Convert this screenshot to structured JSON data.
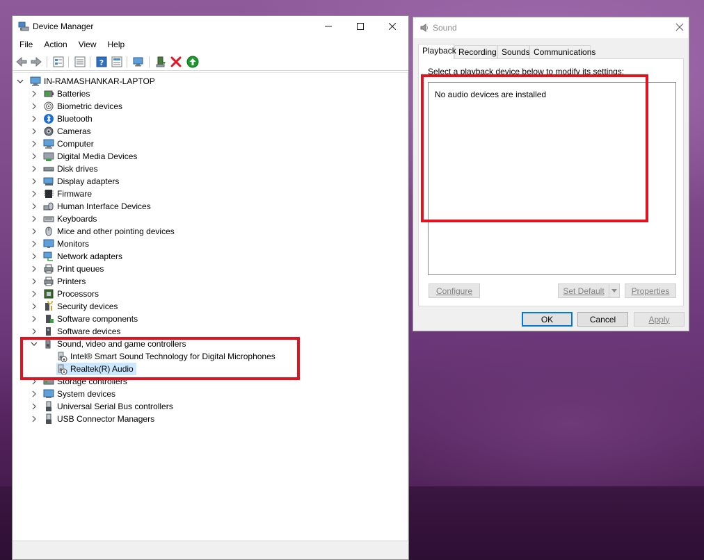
{
  "device_manager": {
    "title": "Device Manager",
    "menu": [
      "File",
      "Action",
      "View",
      "Help"
    ],
    "root": "IN-RAMASHANKAR-LAPTOP",
    "categories": [
      {
        "label": "Batteries",
        "icon": "battery-icon"
      },
      {
        "label": "Biometric devices",
        "icon": "fingerprint-icon"
      },
      {
        "label": "Bluetooth",
        "icon": "bluetooth-icon"
      },
      {
        "label": "Cameras",
        "icon": "camera-icon"
      },
      {
        "label": "Computer",
        "icon": "computer-icon"
      },
      {
        "label": "Digital Media Devices",
        "icon": "media-device-icon"
      },
      {
        "label": "Disk drives",
        "icon": "disk-drive-icon"
      },
      {
        "label": "Display adapters",
        "icon": "display-adapter-icon"
      },
      {
        "label": "Firmware",
        "icon": "firmware-icon"
      },
      {
        "label": "Human Interface Devices",
        "icon": "hid-icon"
      },
      {
        "label": "Keyboards",
        "icon": "keyboard-icon"
      },
      {
        "label": "Mice and other pointing devices",
        "icon": "mouse-icon"
      },
      {
        "label": "Monitors",
        "icon": "monitor-icon"
      },
      {
        "label": "Network adapters",
        "icon": "network-adapter-icon"
      },
      {
        "label": "Print queues",
        "icon": "print-queue-icon"
      },
      {
        "label": "Printers",
        "icon": "printer-icon"
      },
      {
        "label": "Processors",
        "icon": "processor-icon"
      },
      {
        "label": "Security devices",
        "icon": "security-device-icon"
      },
      {
        "label": "Software components",
        "icon": "software-component-icon"
      },
      {
        "label": "Software devices",
        "icon": "software-device-icon"
      },
      {
        "label": "Sound, video and game controllers",
        "icon": "speaker-icon",
        "expanded": true
      },
      {
        "label": "Storage controllers",
        "icon": "storage-controller-icon"
      },
      {
        "label": "System devices",
        "icon": "system-device-icon"
      },
      {
        "label": "Universal Serial Bus controllers",
        "icon": "usb-icon"
      },
      {
        "label": "USB Connector Managers",
        "icon": "usb-connector-icon"
      }
    ],
    "sound_children": [
      {
        "label": "Intel® Smart Sound Technology for Digital Microphones",
        "icon": "disabled-speaker-icon"
      },
      {
        "label": "Realtek(R) Audio",
        "icon": "disabled-speaker-icon",
        "selected": true
      }
    ]
  },
  "sound": {
    "title": "Sound",
    "tabs": [
      "Playback",
      "Recording",
      "Sounds",
      "Communications"
    ],
    "active_tab": "Playback",
    "instruction": "Select a playback device below to modify its settings:",
    "empty_message": "No audio devices are installed",
    "buttons": {
      "configure": "Configure",
      "set_default": "Set Default",
      "properties": "Properties",
      "ok": "OK",
      "cancel": "Cancel",
      "apply": "Apply"
    }
  },
  "colors": {
    "highlight": "#e0131f",
    "selection": "#cce8ff",
    "accent": "#0078d7"
  }
}
